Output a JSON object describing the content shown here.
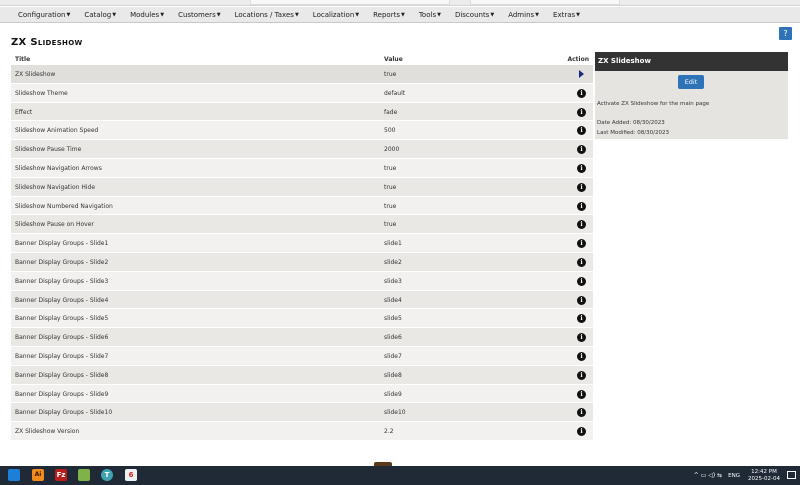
{
  "menu": [
    {
      "label": "Configuration"
    },
    {
      "label": "Catalog"
    },
    {
      "label": "Modules"
    },
    {
      "label": "Customers"
    },
    {
      "label": "Locations / Taxes"
    },
    {
      "label": "Localization"
    },
    {
      "label": "Reports"
    },
    {
      "label": "Tools"
    },
    {
      "label": "Discounts"
    },
    {
      "label": "Admins"
    },
    {
      "label": "Extras"
    }
  ],
  "help_label": "?",
  "page_title": "ZX Slideshow",
  "table": {
    "headers": {
      "title": "Title",
      "value": "Value",
      "action": "Action"
    },
    "rows": [
      {
        "title": "ZX Slideshow",
        "value": "true",
        "action": "arrow-icon"
      },
      {
        "title": "Slideshow Theme",
        "value": "default",
        "action": "info-icon"
      },
      {
        "title": "Effect",
        "value": "fade",
        "action": "info-icon"
      },
      {
        "title": "Slideshow Animation Speed",
        "value": "500",
        "action": "info-icon"
      },
      {
        "title": "Slideshow Pause Time",
        "value": "2000",
        "action": "info-icon"
      },
      {
        "title": "Slideshow Navigation Arrows",
        "value": "true",
        "action": "info-icon"
      },
      {
        "title": "Slideshow Navigation Hide",
        "value": "true",
        "action": "info-icon"
      },
      {
        "title": "Slideshow Numbered Navigation",
        "value": "true",
        "action": "info-icon"
      },
      {
        "title": "Slideshow Pause on Hover",
        "value": "true",
        "action": "info-icon"
      },
      {
        "title": "Banner Display Groups - Slide1",
        "value": "slide1",
        "action": "info-icon"
      },
      {
        "title": "Banner Display Groups - Slide2",
        "value": "slide2",
        "action": "info-icon"
      },
      {
        "title": "Banner Display Groups - Slide3",
        "value": "slide3",
        "action": "info-icon"
      },
      {
        "title": "Banner Display Groups - Slide4",
        "value": "slide4",
        "action": "info-icon"
      },
      {
        "title": "Banner Display Groups - Slide5",
        "value": "slide5",
        "action": "info-icon"
      },
      {
        "title": "Banner Display Groups - Slide6",
        "value": "slide6",
        "action": "info-icon"
      },
      {
        "title": "Banner Display Groups - Slide7",
        "value": "slide7",
        "action": "info-icon"
      },
      {
        "title": "Banner Display Groups - Slide8",
        "value": "slide8",
        "action": "info-icon"
      },
      {
        "title": "Banner Display Groups - Slide9",
        "value": "slide9",
        "action": "info-icon"
      },
      {
        "title": "Banner Display Groups - Slide10",
        "value": "slide10",
        "action": "info-icon"
      },
      {
        "title": "ZX Slideshow Version",
        "value": "2.2",
        "action": "info-icon"
      }
    ]
  },
  "side_panel": {
    "title": "ZX Slideshow",
    "edit_label": "Edit",
    "description": "Activate ZX Slideshow for the main page",
    "date_added": "Date Added: 08/30/2023",
    "last_modified": "Last Modified: 08/30/2023"
  },
  "taskbar": {
    "app_ai": "Ai",
    "app_filezilla": "Fz",
    "app_teams": "T",
    "app_6": "6",
    "tray_icons": "^ ▭ ◁) ⇆",
    "language": "ENG",
    "time": "12:42 PM",
    "date": "2025-02-04"
  },
  "colors": {
    "accent": "#2e73b8",
    "panel_head": "#333333",
    "menubar": "#e9e9e9"
  }
}
